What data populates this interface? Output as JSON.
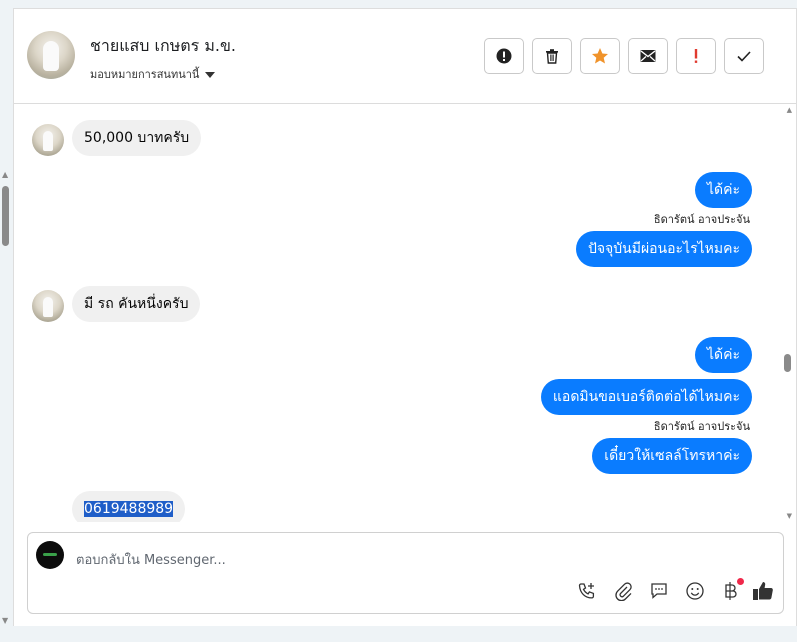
{
  "header": {
    "contact_name": "ชายแสบ เกษตร ม.ข.",
    "assign_label": "มอบหมายการสนทนานี้",
    "actions": [
      "alert-icon",
      "trash-icon",
      "star-icon",
      "mail-icon",
      "exclamation-icon",
      "check-icon"
    ]
  },
  "messages": [
    {
      "dir": "in",
      "text": "50,000 บาทครับ"
    },
    {
      "dir": "out",
      "text": "ได้ค่ะ"
    },
    {
      "dir": "sender",
      "text": "ธิดารัตน์ อาจประจัน"
    },
    {
      "dir": "out",
      "text": "ปัจจุบันมีผ่อนอะไรไหมคะ"
    },
    {
      "dir": "in",
      "text": "มี รถ คันหนึ่งครับ"
    },
    {
      "dir": "out",
      "text": "ได้ค่ะ"
    },
    {
      "dir": "out",
      "text": "แอดมินขอเบอร์ติดต่อได้ไหมคะ"
    },
    {
      "dir": "sender",
      "text": "ธิดารัตน์ อาจประจัน"
    },
    {
      "dir": "out",
      "text": "เดี๋ยวให้เซลล์โทรหาค่ะ"
    },
    {
      "dir": "in",
      "text": "0619488989"
    }
  ],
  "composer": {
    "placeholder": "ตอบกลับใน Messenger...",
    "icons": [
      "call-add-icon",
      "paperclip-icon",
      "chat-bubble-icon",
      "emoji-icon",
      "baht-icon",
      "thumbs-up-icon"
    ]
  },
  "colors": {
    "outgoing": "#0a7cff",
    "incoming": "#f0f0f0",
    "accent_star": "#f0932b",
    "accent_alert": "#e03a2f"
  }
}
